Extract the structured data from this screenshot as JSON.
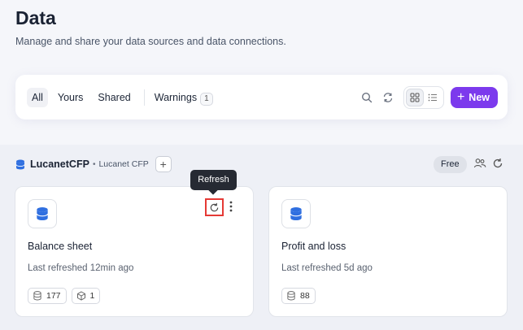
{
  "header": {
    "title": "Data",
    "subtitle": "Manage and share your data sources and data connections."
  },
  "toolbar": {
    "filters": [
      "All",
      "Yours",
      "Shared"
    ],
    "warnings_label": "Warnings",
    "warnings_count": "1",
    "new_label": "New",
    "icons": [
      "search-icon",
      "sync-icon",
      "grid-view-icon",
      "list-view-icon"
    ]
  },
  "section": {
    "name": "LucanetCFP",
    "sub": "Lucanet CFP",
    "badge": "Free"
  },
  "tooltip": "Refresh",
  "cards": [
    {
      "title": "Balance sheet",
      "meta": "Last refreshed 12min ago",
      "chips": [
        "177",
        "1"
      ]
    },
    {
      "title": "Profit and loss",
      "meta": "Last refreshed 5d ago",
      "chips": [
        "88"
      ]
    }
  ],
  "colors": {
    "accent": "#7c3aed",
    "db_icon": "#2f6fe0",
    "highlight": "#e53935"
  }
}
